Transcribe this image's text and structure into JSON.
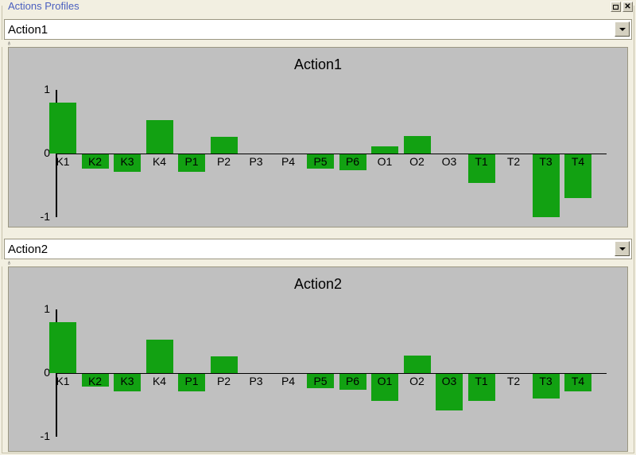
{
  "window": {
    "group_title": "Actions Profiles",
    "restore_button_label": "□",
    "close_button_label": "×",
    "splitter_grip_glyph": "♁"
  },
  "sections": [
    {
      "combo_value": "Action1",
      "combo_caret_icon": "chevron-down-icon",
      "chart_index": 0
    },
    {
      "combo_value": "Action2",
      "combo_caret_icon": "chevron-down-icon",
      "chart_index": 1
    }
  ],
  "colors": {
    "bar": "#12a112",
    "plot_background": "#c0c0c0",
    "group_title": "#4a5fbf",
    "window_background": "#f2efe1",
    "axis": "#000000"
  },
  "chart_data": [
    {
      "type": "bar",
      "title": "Action1",
      "xlabel": "",
      "ylabel": "",
      "ylim": [
        -1,
        1
      ],
      "yticks": [
        1,
        0,
        -1
      ],
      "ytick_labels": [
        "1",
        "0",
        "-1"
      ],
      "grid": false,
      "legend": "none",
      "categories": [
        "K1",
        "K2",
        "K3",
        "K4",
        "P1",
        "P2",
        "P3",
        "P4",
        "P5",
        "P6",
        "O1",
        "O2",
        "O3",
        "T1",
        "T2",
        "T3",
        "T4"
      ],
      "values": [
        0.8,
        -0.23,
        -0.28,
        0.53,
        -0.27,
        0.26,
        0.0,
        0.0,
        -0.22,
        -0.25,
        0.11,
        0.27,
        0.0,
        -0.45,
        0.0,
        -0.99,
        -0.69
      ]
    },
    {
      "type": "bar",
      "title": "Action2",
      "xlabel": "",
      "ylabel": "",
      "ylim": [
        -1,
        1
      ],
      "yticks": [
        1,
        0,
        -1
      ],
      "ytick_labels": [
        "1",
        "0",
        "-1"
      ],
      "grid": false,
      "legend": "none",
      "categories": [
        "K1",
        "K2",
        "K3",
        "K4",
        "P1",
        "P2",
        "P3",
        "P4",
        "P5",
        "P6",
        "O1",
        "O2",
        "O3",
        "T1",
        "T2",
        "T3",
        "T4"
      ],
      "values": [
        0.8,
        -0.2,
        -0.28,
        0.53,
        -0.27,
        0.26,
        0.0,
        0.0,
        -0.22,
        -0.25,
        -0.42,
        0.27,
        -0.58,
        -0.42,
        0.0,
        -0.39,
        -0.27
      ]
    }
  ]
}
